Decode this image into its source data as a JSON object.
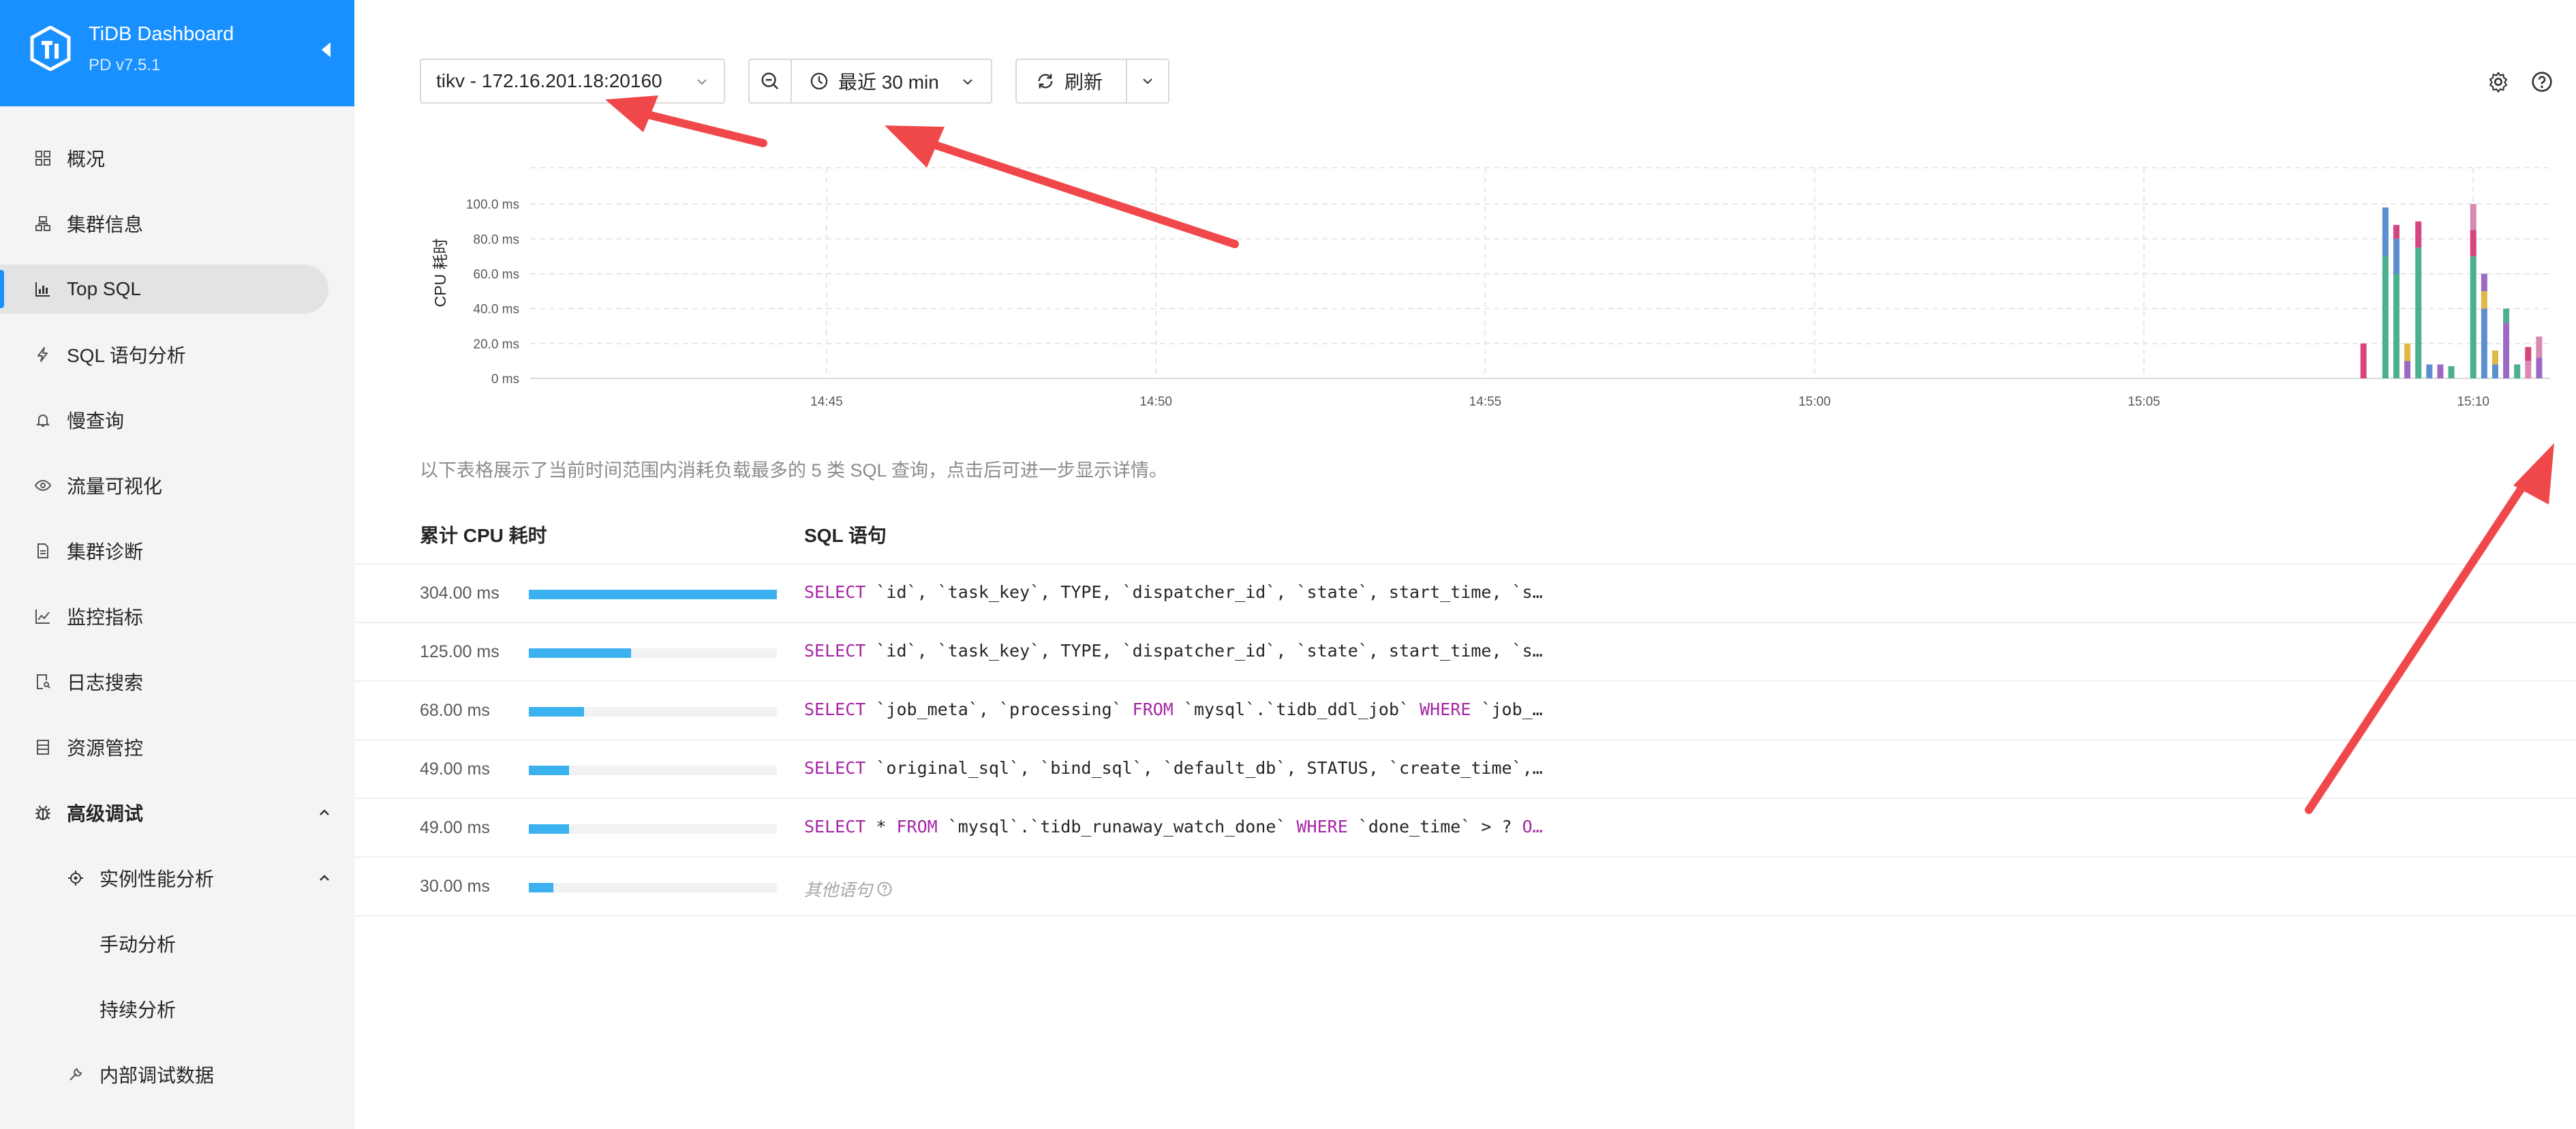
{
  "sidebar": {
    "app_name": "TiDB Dashboard",
    "version": "PD v7.5.1",
    "items": [
      {
        "label": "概况",
        "icon": "overview-icon"
      },
      {
        "label": "集群信息",
        "icon": "cluster-icon"
      },
      {
        "label": "Top SQL",
        "icon": "chart-bar-icon",
        "active": true
      },
      {
        "label": "SQL 语句分析",
        "icon": "bolt-icon"
      },
      {
        "label": "慢查询",
        "icon": "bell-icon"
      },
      {
        "label": "流量可视化",
        "icon": "eye-icon"
      },
      {
        "label": "集群诊断",
        "icon": "file-icon"
      },
      {
        "label": "监控指标",
        "icon": "line-chart-icon"
      },
      {
        "label": "日志搜索",
        "icon": "file-search-icon"
      },
      {
        "label": "资源管控",
        "icon": "database-icon"
      },
      {
        "label": "高级调试",
        "icon": "bug-icon",
        "expanded": true
      },
      {
        "label": "实例性能分析",
        "icon": "aim-icon",
        "expanded": true
      },
      {
        "label": "手动分析"
      },
      {
        "label": "持续分析"
      },
      {
        "label": "内部调试数据",
        "icon": "tool-icon"
      }
    ]
  },
  "toolbar": {
    "instance": "tikv - 172.16.201.18:20160",
    "time_range": "最近 30 min",
    "refresh": "刷新"
  },
  "chart_data": {
    "type": "bar",
    "stacked": true,
    "ylabel": "CPU 耗时",
    "y_ticks": [
      "0 ms",
      "20.0 ms",
      "40.0 ms",
      "60.0 ms",
      "80.0 ms",
      "100.0 ms"
    ],
    "ylim": [
      0,
      120
    ],
    "x_ticks": [
      "14:45",
      "14:50",
      "14:55",
      "15:00",
      "15:05",
      "15:10"
    ],
    "grid": true,
    "colors": [
      "#d6457d",
      "#4bb08f",
      "#5b8fcf",
      "#e0b84a",
      "#9c6ac6",
      "#d98ab3"
    ],
    "bars": [
      {
        "x": "15:08:20",
        "stack": [
          {
            "c": 0,
            "v": 20
          }
        ]
      },
      {
        "x": "15:08:40",
        "stack": [
          {
            "c": 1,
            "v": 70
          },
          {
            "c": 2,
            "v": 28
          }
        ]
      },
      {
        "x": "15:08:50",
        "stack": [
          {
            "c": 1,
            "v": 60
          },
          {
            "c": 2,
            "v": 20
          },
          {
            "c": 0,
            "v": 8
          }
        ]
      },
      {
        "x": "15:09:00",
        "stack": [
          {
            "c": 4,
            "v": 10
          },
          {
            "c": 3,
            "v": 10
          }
        ]
      },
      {
        "x": "15:09:10",
        "stack": [
          {
            "c": 1,
            "v": 75
          },
          {
            "c": 0,
            "v": 15
          }
        ]
      },
      {
        "x": "15:09:20",
        "stack": [
          {
            "c": 2,
            "v": 8
          }
        ]
      },
      {
        "x": "15:09:30",
        "stack": [
          {
            "c": 4,
            "v": 8
          }
        ]
      },
      {
        "x": "15:09:40",
        "stack": [
          {
            "c": 1,
            "v": 7
          }
        ]
      },
      {
        "x": "15:10:00",
        "stack": [
          {
            "c": 1,
            "v": 70
          },
          {
            "c": 0,
            "v": 15
          },
          {
            "c": 5,
            "v": 15
          }
        ]
      },
      {
        "x": "15:10:10",
        "stack": [
          {
            "c": 2,
            "v": 40
          },
          {
            "c": 3,
            "v": 10
          },
          {
            "c": 4,
            "v": 10
          }
        ]
      },
      {
        "x": "15:10:20",
        "stack": [
          {
            "c": 2,
            "v": 8
          },
          {
            "c": 3,
            "v": 8
          }
        ]
      },
      {
        "x": "15:10:30",
        "stack": [
          {
            "c": 4,
            "v": 32
          },
          {
            "c": 1,
            "v": 8
          }
        ]
      },
      {
        "x": "15:10:40",
        "stack": [
          {
            "c": 1,
            "v": 8
          }
        ]
      },
      {
        "x": "15:10:50",
        "stack": [
          {
            "c": 5,
            "v": 10
          },
          {
            "c": 0,
            "v": 8
          }
        ]
      },
      {
        "x": "15:11:00",
        "stack": [
          {
            "c": 4,
            "v": 12
          },
          {
            "c": 5,
            "v": 12
          }
        ]
      }
    ]
  },
  "description": "以下表格展示了当前时间范围内消耗负载最多的 5 类 SQL 查询，点击后可进一步显示详情。",
  "table": {
    "col_cpu": "累计 CPU 耗时",
    "col_sql": "SQL 语句",
    "max_cpu": 304,
    "rows": [
      {
        "cpu": "304.00 ms",
        "value": 304,
        "sql": [
          [
            "kw",
            "SELECT"
          ],
          [
            "t",
            " `id`, `task_key`, TYPE, `dispatcher_id`, `state`, start_time, `s…"
          ]
        ]
      },
      {
        "cpu": "125.00 ms",
        "value": 125,
        "sql": [
          [
            "kw",
            "SELECT"
          ],
          [
            "t",
            " `id`, `task_key`, TYPE, `dispatcher_id`, `state`, start_time, `s…"
          ]
        ]
      },
      {
        "cpu": "68.00 ms",
        "value": 68,
        "sql": [
          [
            "kw",
            "SELECT"
          ],
          [
            "t",
            " `job_meta`, `processing` "
          ],
          [
            "kw",
            "FROM"
          ],
          [
            "t",
            " `mysql`.`tidb_ddl_job` "
          ],
          [
            "kw",
            "WHERE"
          ],
          [
            "t",
            " `job_…"
          ]
        ]
      },
      {
        "cpu": "49.00 ms",
        "value": 49,
        "sql": [
          [
            "kw",
            "SELECT"
          ],
          [
            "t",
            " `original_sql`, `bind_sql`, `default_db`, STATUS, `create_time`,…"
          ]
        ]
      },
      {
        "cpu": "49.00 ms",
        "value": 49,
        "sql": [
          [
            "kw",
            "SELECT"
          ],
          [
            "t",
            " * "
          ],
          [
            "kw",
            "FROM"
          ],
          [
            "t",
            " `mysql`.`tidb_runaway_watch_done` "
          ],
          [
            "kw",
            "WHERE"
          ],
          [
            "t",
            " `done_time` > ? "
          ],
          [
            "kw",
            "O…"
          ]
        ]
      }
    ],
    "other": {
      "cpu": "30.00 ms",
      "value": 30,
      "label": "其他语句"
    }
  },
  "annotation_color": "#f0484a"
}
